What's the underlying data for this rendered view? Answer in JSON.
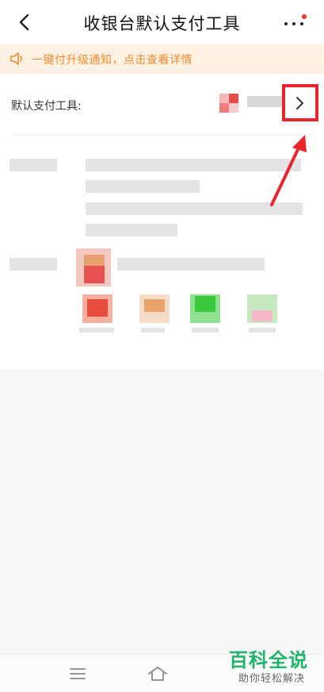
{
  "header": {
    "title": "收银台默认支付工具",
    "back_icon": "chevron-left-icon",
    "more_icon": "more-dots-icon",
    "badge_color": "#ff2b2b"
  },
  "notice": {
    "text": "一键付升级通知，点击查看详情",
    "icon": "speaker-icon",
    "text_color": "#f08a2a",
    "bg_color": "#fdf1e4"
  },
  "default_tool": {
    "label": "默认支付工具:",
    "chevron_icon": "chevron-right-icon",
    "highlight_color": "#e8262b"
  },
  "navbar": {
    "menu_icon": "menu-icon",
    "home_icon": "home-icon"
  },
  "watermark": {
    "title": "百科全说",
    "subtitle": "助你轻松解决",
    "color": "#1fb46b"
  }
}
